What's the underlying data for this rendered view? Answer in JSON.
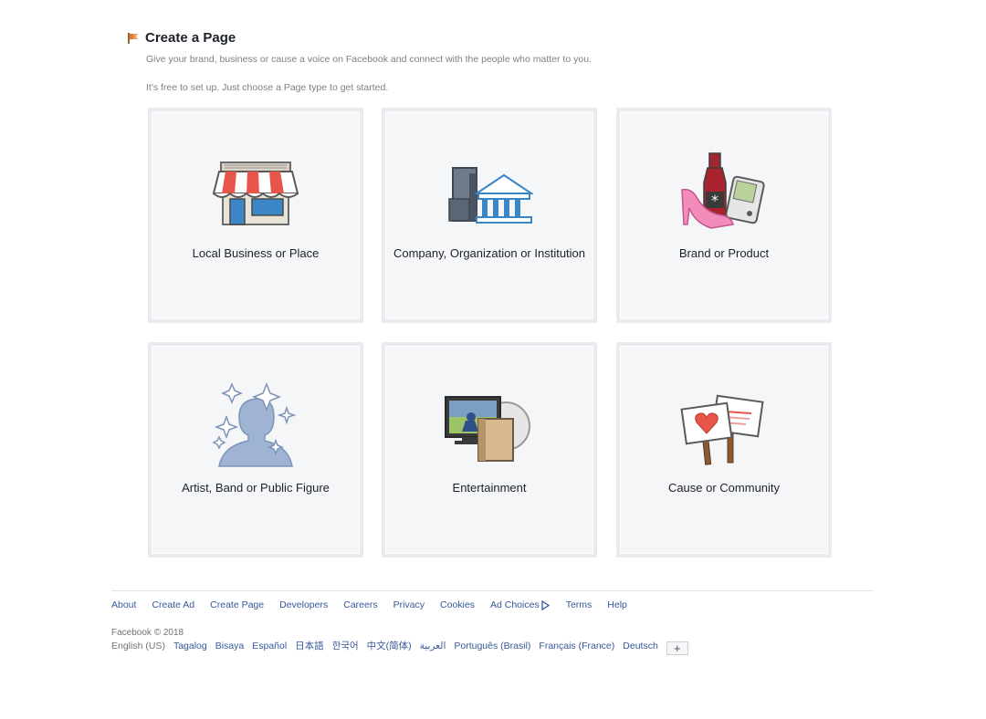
{
  "header": {
    "title": "Create a Page",
    "description": "Give your brand, business or cause a voice on Facebook and connect with the people who matter to you.",
    "subtext": "It's free to set up. Just choose a Page type to get started."
  },
  "categories": [
    {
      "label": "Local Business or Place",
      "icon": "storefront-icon"
    },
    {
      "label": "Company, Organization or Institution",
      "icon": "buildings-icon"
    },
    {
      "label": "Brand or Product",
      "icon": "products-icon"
    },
    {
      "label": "Artist, Band or Public Figure",
      "icon": "public-figure-icon"
    },
    {
      "label": "Entertainment",
      "icon": "entertainment-icon"
    },
    {
      "label": "Cause or Community",
      "icon": "signs-icon"
    }
  ],
  "footer": {
    "links": [
      "About",
      "Create Ad",
      "Create Page",
      "Developers",
      "Careers",
      "Privacy",
      "Cookies",
      "Ad Choices",
      "Terms",
      "Help"
    ],
    "copyright": "Facebook © 2018",
    "current_language": "English (US)",
    "languages": [
      "Tagalog",
      "Bisaya",
      "Español",
      "日本語",
      "한국어",
      "中文(简体)",
      "العربية",
      "Português (Brasil)",
      "Français (France)",
      "Deutsch"
    ],
    "more_label": "+"
  },
  "colors": {
    "link": "#365899",
    "tile_bg": "#f5f6f7",
    "tile_border": "#e9ebee"
  }
}
